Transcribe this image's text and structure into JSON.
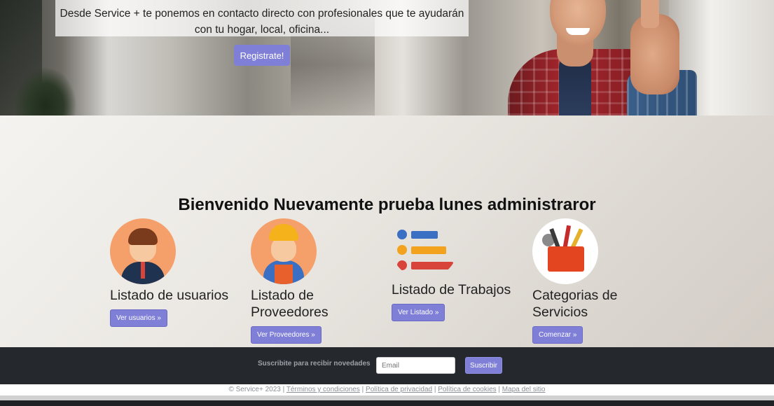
{
  "hero": {
    "text": "Desde Service + te ponemos en contacto directo con profesionales que te ayudarán con tu hogar, local, oficina...",
    "register_label": "Registrate!"
  },
  "main": {
    "welcome": "Bienvenido Nuevamente prueba lunes administraror",
    "cards": [
      {
        "title": "Listado de usuarios",
        "button": "Ver usuarios »",
        "icon": "user-icon"
      },
      {
        "title": "Listado de Proveedores",
        "button": "Ver Proveedores »",
        "icon": "worker-icon"
      },
      {
        "title": "Listado de Trabajos",
        "button": "Ver Listado »",
        "icon": "list-icon"
      },
      {
        "title": "Categorias de Servicios",
        "button": "Comenzar »",
        "icon": "toolbox-icon"
      }
    ]
  },
  "footer": {
    "newsletter_label": "Suscribite para recibir novedades",
    "email_placeholder": "Email",
    "subscribe_label": "Suscribir",
    "copyright": "© Service+ 2023 |",
    "links": [
      "Términos y condiciones",
      "Política de privacidad",
      "Política de cookies",
      "Mapa del sitio"
    ]
  },
  "colors": {
    "accent": "#7f7fd8",
    "footer_bg": "#25282d",
    "list_blue": "#3a6fc4",
    "list_orange": "#f2a21c",
    "list_red": "#d8433a"
  }
}
